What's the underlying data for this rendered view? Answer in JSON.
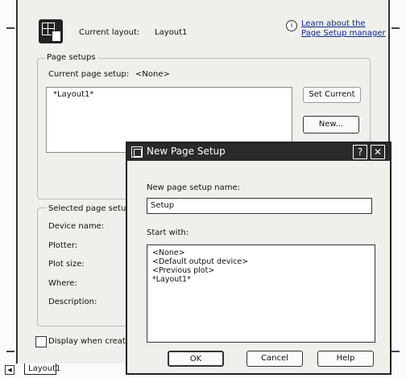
{
  "page_setup_manager": {
    "current_layout_label": "Current layout:",
    "current_layout_value": "Layout1",
    "help_link": [
      "Learn about the",
      "Page Setup manager"
    ],
    "page_setups_group": "Page setups",
    "current_page_setup_label": "Current page setup:",
    "current_page_setup_value": "<None>",
    "setups": [
      "*Layout1*"
    ],
    "set_current_button": "Set Current",
    "new_button": "New...",
    "selected_group": "Selected page setup",
    "details": [
      "Device name:",
      "Plotter:",
      "Plot size:",
      "Where:",
      "Description:"
    ],
    "display_checkbox_label": "Display when creat"
  },
  "tabs": [
    "Layout1"
  ],
  "new_page_setup": {
    "title": "New Page Setup",
    "name_label": "New page setup name:",
    "name_value": "Setup",
    "start_with_label": "Start with:",
    "start_with_items": [
      "<None>",
      "<Default output device>",
      "<Previous plot>",
      "*Layout1*"
    ],
    "ok_button": "OK",
    "cancel_button": "Cancel",
    "help_button": "Help"
  }
}
